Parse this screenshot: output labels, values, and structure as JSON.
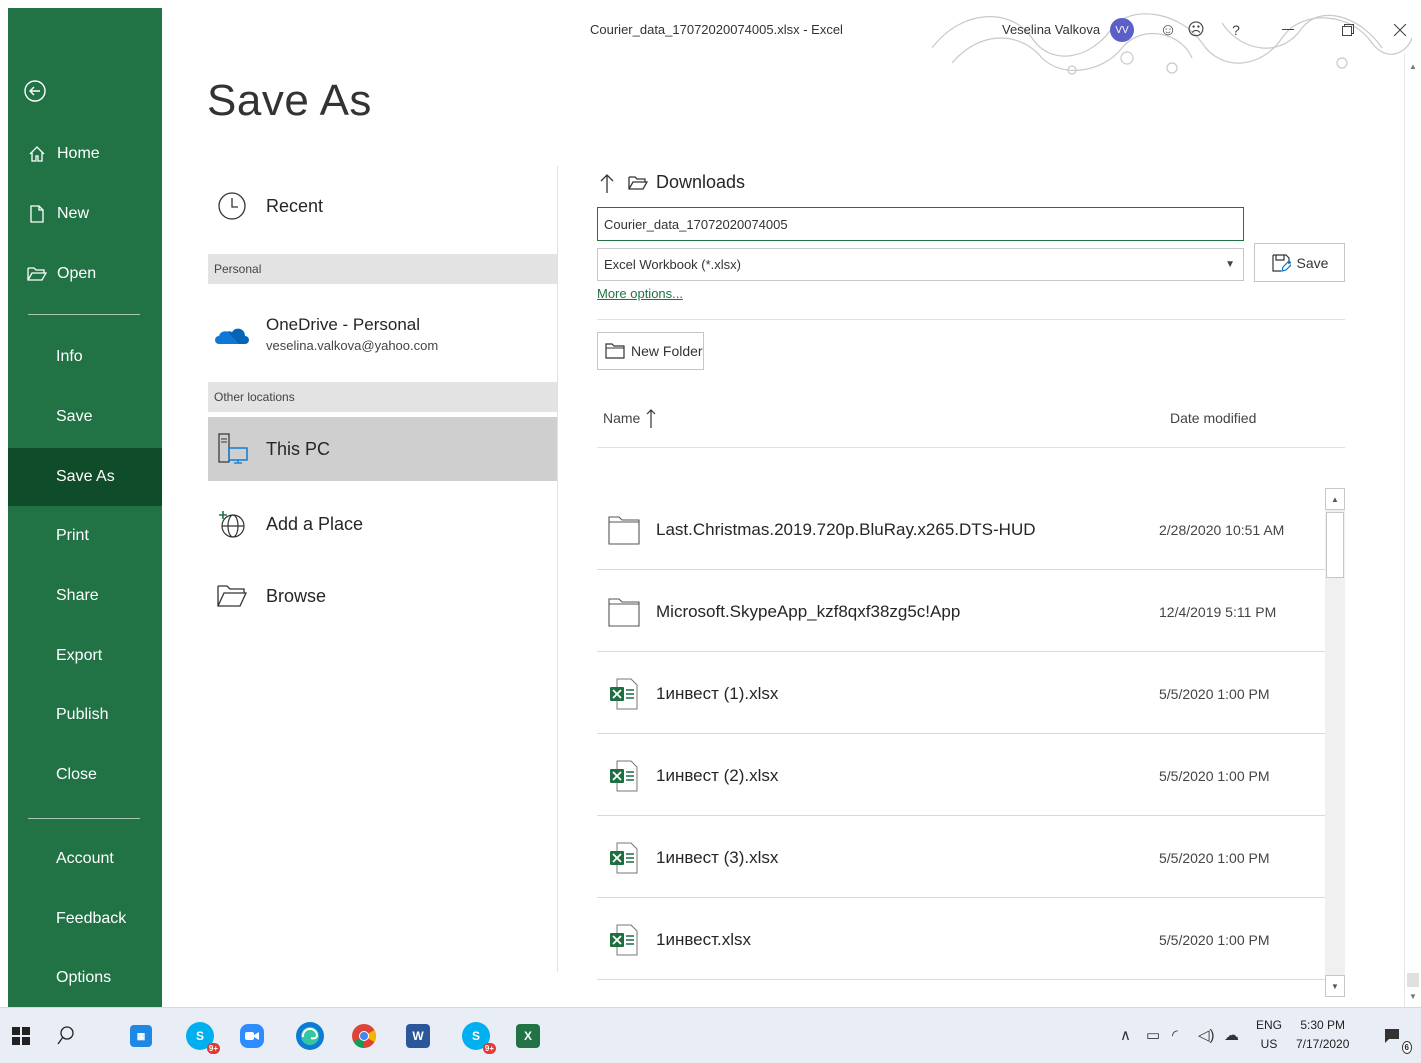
{
  "window": {
    "title": "Courier_data_17072020074005.xlsx  -  Excel",
    "user_name": "Veselina Valkova",
    "user_initials": "VV",
    "help_label": "?"
  },
  "sidebar": {
    "items": [
      {
        "label": "Home"
      },
      {
        "label": "New"
      },
      {
        "label": "Open"
      },
      {
        "label": "Info"
      },
      {
        "label": "Save"
      },
      {
        "label": "Save As"
      },
      {
        "label": "Print"
      },
      {
        "label": "Share"
      },
      {
        "label": "Export"
      },
      {
        "label": "Publish"
      },
      {
        "label": "Close"
      },
      {
        "label": "Account"
      },
      {
        "label": "Feedback"
      },
      {
        "label": "Options"
      }
    ],
    "active": "Save As",
    "color": "#217346",
    "active_color": "#0f4c2a"
  },
  "page": {
    "title": "Save As"
  },
  "locations": {
    "recent": "Recent",
    "personal_header": "Personal",
    "onedrive_name": "OneDrive - Personal",
    "onedrive_email": "veselina.valkova@yahoo.com",
    "other_header": "Other locations",
    "this_pc": "This PC",
    "add_place": "Add a Place",
    "browse": "Browse",
    "selected": "This PC"
  },
  "save_pane": {
    "current_folder": "Downloads",
    "filename": "Courier_data_17072020074005",
    "filetype": "Excel Workbook (*.xlsx)",
    "save_label": "Save",
    "more_options": "More options...",
    "new_folder": "New Folder",
    "col_name": "Name",
    "col_date": "Date modified"
  },
  "files": [
    {
      "name": "Last.Christmas.2019.720p.BluRay.x265.DTS-HUD",
      "date": "2/28/2020 10:51 AM",
      "type": "folder-icon"
    },
    {
      "name": "Microsoft.SkypeApp_kzf8qxf38zg5c!App",
      "date": "12/4/2019 5:11 PM",
      "type": "folder-icon"
    },
    {
      "name": "1инвест (1).xlsx",
      "date": "5/5/2020 1:00 PM",
      "type": "excel-file-icon"
    },
    {
      "name": "1инвест (2).xlsx",
      "date": "5/5/2020 1:00 PM",
      "type": "excel-file-icon"
    },
    {
      "name": "1инвест (3).xlsx",
      "date": "5/5/2020 1:00 PM",
      "type": "excel-file-icon"
    },
    {
      "name": "1инвест.xlsx",
      "date": "5/5/2020 1:00 PM",
      "type": "excel-file-icon"
    }
  ],
  "taskbar": {
    "badge_skype_1": "9+",
    "badge_skype_2": "9+",
    "lang_top": "ENG",
    "lang_bottom": "US",
    "time": "5:30 PM",
    "date": "7/17/2020",
    "notifications": "6"
  }
}
